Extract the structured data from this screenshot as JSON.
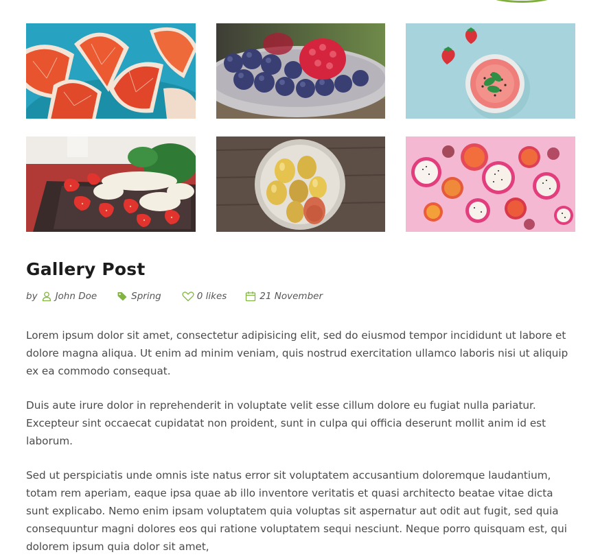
{
  "gallery": {
    "images": [
      {
        "name": "grapefruit-slices"
      },
      {
        "name": "berries-bowl"
      },
      {
        "name": "strawberry-smoothie"
      },
      {
        "name": "strawberry-banana-plate"
      },
      {
        "name": "pears-bowl"
      },
      {
        "name": "dragonfruit-citrus"
      }
    ]
  },
  "post": {
    "title": "Gallery Post",
    "meta": {
      "by_label": "by",
      "author": "John Doe",
      "category": "Spring",
      "likes": "0 likes",
      "date": "21 November"
    },
    "paragraphs": [
      "Lorem ipsum dolor sit amet, consectetur adipisicing elit, sed do eiusmod tempor incididunt ut labore et dolore magna aliqua. Ut enim ad minim veniam, quis nostrud exercitation ullamco laboris nisi ut aliquip ex ea commodo consequat.",
      "Duis aute irure dolor in reprehenderit in voluptate velit esse cillum dolore eu fugiat nulla pariatur. Excepteur sint occaecat cupidatat non proident, sunt in culpa qui officia deserunt mollit anim id est laborum.",
      "Sed ut perspiciatis unde omnis iste natus error sit voluptatem accusantium doloremque laudantium, totam rem aperiam, eaque ipsa quae ab illo inventore veritatis et quasi architecto beatae vitae dicta sunt explicabo. Nemo enim ipsam voluptatem quia voluptas sit aspernatur aut odit aut fugit, sed quia consequuntur magni dolores eos qui ratione voluptatem sequi nesciunt. Neque porro quisquam est, qui dolorem ipsum quia dolor sit amet,"
    ]
  },
  "colors": {
    "accent": "#81b441",
    "title": "#1c1c1c",
    "text": "#4a4a4a"
  },
  "icons": {
    "author": "user-icon",
    "category": "tag-icon",
    "likes": "heart-icon",
    "date": "calendar-icon"
  }
}
